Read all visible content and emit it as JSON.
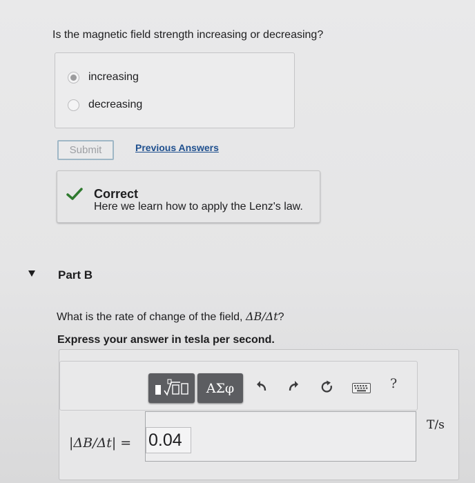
{
  "question1": {
    "text": "Is the magnetic field strength increasing or decreasing?"
  },
  "choices": [
    {
      "label": "increasing",
      "selected": true
    },
    {
      "label": "decreasing",
      "selected": false
    }
  ],
  "actions": {
    "submit_label": "Submit",
    "previous_answers_label": "Previous Answers"
  },
  "feedback": {
    "title": "Correct",
    "message": "Here we learn how to apply the Lenz's law.",
    "icon": "check-icon",
    "accent_color": "#2f7a2f"
  },
  "partB": {
    "title": "Part B",
    "question_prefix": "What is the rate of change of the field, ",
    "question_math": "ΔB/Δt",
    "question_suffix": "?",
    "instruction": "Express your answer in tesla per second.",
    "toolbar": {
      "templates_icon": "templates-icon",
      "symbols_label": "ΑΣφ",
      "undo_icon": "undo-icon",
      "redo_icon": "redo-icon",
      "reset_icon": "reset-icon",
      "keyboard_icon": "keyboard-icon",
      "help_label": "?"
    },
    "lhs_prefix": "|ΔB/Δt|",
    "lhs_equals": " =",
    "answer_value": "0.04",
    "unit": "T/s"
  }
}
